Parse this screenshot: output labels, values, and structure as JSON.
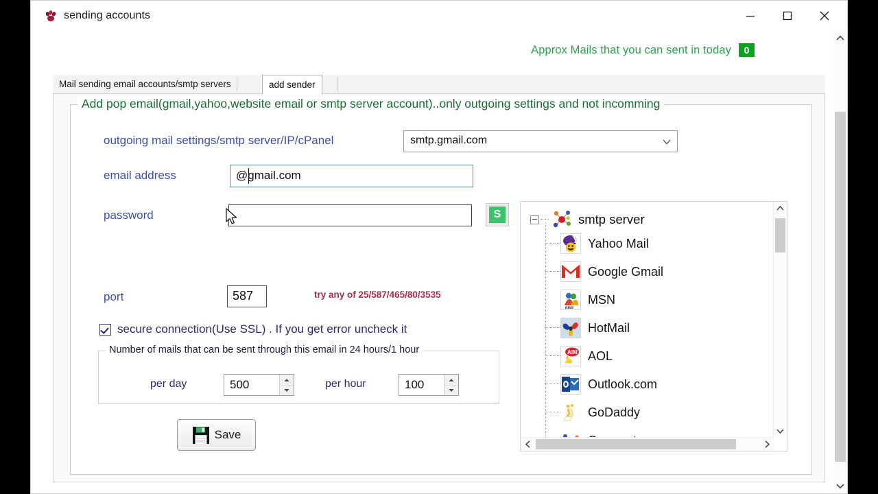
{
  "window": {
    "title": "sending accounts",
    "app_icon": "paw-icon",
    "controls": {
      "minimize": "minimize-icon",
      "maximize": "maximize-icon",
      "close": "close-icon"
    }
  },
  "header": {
    "approx_text": "Approx Mails that you can sent in today",
    "approx_count": "0",
    "approx_color": "#2f9e4f",
    "badge_color": "#0aa11e"
  },
  "tabs": [
    {
      "label": "Mail sending email accounts/smtp servers",
      "selected": false
    },
    {
      "label": "add sender",
      "selected": true
    }
  ],
  "groupbox": {
    "title": "Add pop email(gmail,yahoo,website email or smtp server account)..only outgoing settings and not incomming",
    "title_color": "#1d6b35"
  },
  "form": {
    "outgoing_label": "outgoing mail settings/smtp server/IP/cPanel",
    "outgoing_value": "smtp.gmail.com",
    "email_label": "email address",
    "email_value": "@gmail.com",
    "password_label": "password",
    "password_value": "",
    "show_password_button": "S",
    "port_label": "port",
    "port_value": "587",
    "port_hint": "try any of 25/587/465/80/3535",
    "port_hint_color": "#a1304b",
    "ssl_label": "secure connection(Use SSL) . If you get error uncheck it",
    "ssl_checked": true,
    "label_color": "#3f4fa8"
  },
  "limits": {
    "title": "Number of mails that can be sent through this email in 24 hours/1 hour",
    "per_day_label": "per day",
    "per_day_value": "500",
    "per_hour_label": "per hour",
    "per_hour_value": "100"
  },
  "save": {
    "label": "Save",
    "icon": "floppy-disk-icon"
  },
  "tree": {
    "root_label": "smtp server",
    "root_icon": "network-nodes-icon",
    "expanded": true,
    "items": [
      {
        "label": "Yahoo Mail",
        "icon": "yahoo-mail-icon"
      },
      {
        "label": "Google Gmail",
        "icon": "gmail-icon"
      },
      {
        "label": "MSN",
        "icon": "msn-icon"
      },
      {
        "label": "HotMail",
        "icon": "hotmail-icon"
      },
      {
        "label": "AOL",
        "icon": "aol-icon"
      },
      {
        "label": "Outlook.com",
        "icon": "outlook-icon"
      },
      {
        "label": "GoDaddy",
        "icon": "godaddy-icon"
      },
      {
        "label": "Comcast",
        "icon": "comcast-icon"
      }
    ]
  }
}
